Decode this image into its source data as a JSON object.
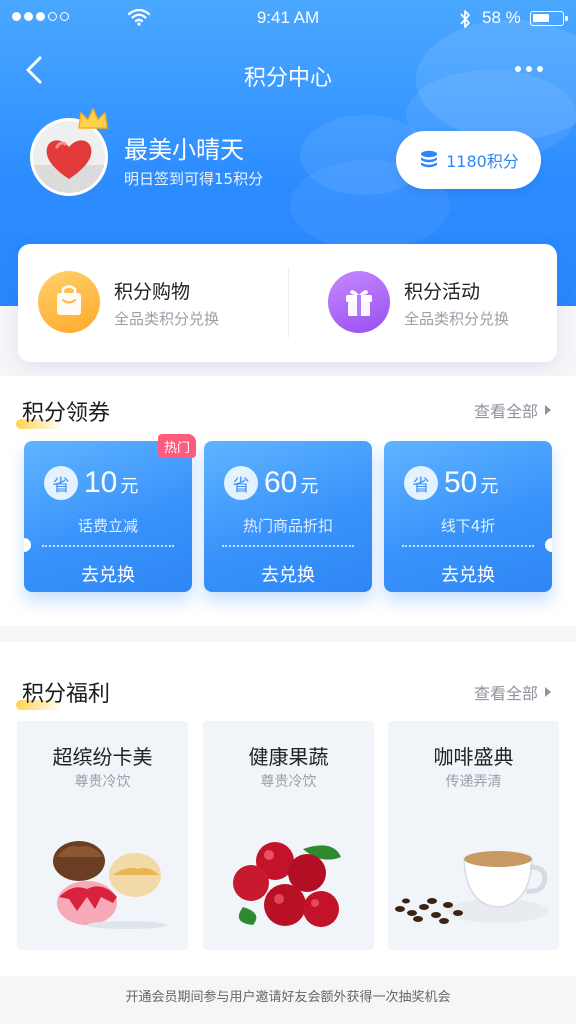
{
  "status_bar": {
    "time": "9:41 AM",
    "battery": "58 %",
    "battery_level": 0.58
  },
  "nav": {
    "title": "积分中心"
  },
  "user": {
    "name": "最美小晴天",
    "subtitle": "明日签到可得15积分",
    "points_label": "1180积分"
  },
  "quick_actions": [
    {
      "title": "积分购物",
      "subtitle": "全品类积分兑换",
      "icon": "shopping-bag-icon",
      "color": "#ffb23e"
    },
    {
      "title": "积分活动",
      "subtitle": "全品类积分兑换",
      "icon": "gift-icon",
      "color": "#a35af0"
    }
  ],
  "coupons_section": {
    "title": "积分领券",
    "more": "查看全部",
    "hot_tag": "热门",
    "items": [
      {
        "save": "省",
        "amount": "10",
        "unit": "元",
        "desc": "话费立减",
        "action": "去兑换"
      },
      {
        "save": "省",
        "amount": "60",
        "unit": "元",
        "desc": "热门商品折扣",
        "action": "去兑换"
      },
      {
        "save": "省",
        "amount": "50",
        "unit": "元",
        "desc": "线下4折",
        "action": "去兑换"
      }
    ]
  },
  "benefits_section": {
    "title": "积分福利",
    "more": "查看全部",
    "items": [
      {
        "title": "超缤纷卡美",
        "subtitle": "尊贵冷饮",
        "image": "ice-cream-image"
      },
      {
        "title": "健康果蔬",
        "subtitle": "尊贵冷饮",
        "image": "cranberries-image"
      },
      {
        "title": "咖啡盛典",
        "subtitle": "传递弄清",
        "image": "coffee-cup-image"
      }
    ]
  },
  "footer": {
    "note": "开通会员期间参与用户邀请好友会额外获得一次抽奖机会"
  },
  "colors": {
    "primary": "#2c8cff",
    "hot": "#ff5b7d",
    "accent_yellow": "#ffd24d"
  }
}
